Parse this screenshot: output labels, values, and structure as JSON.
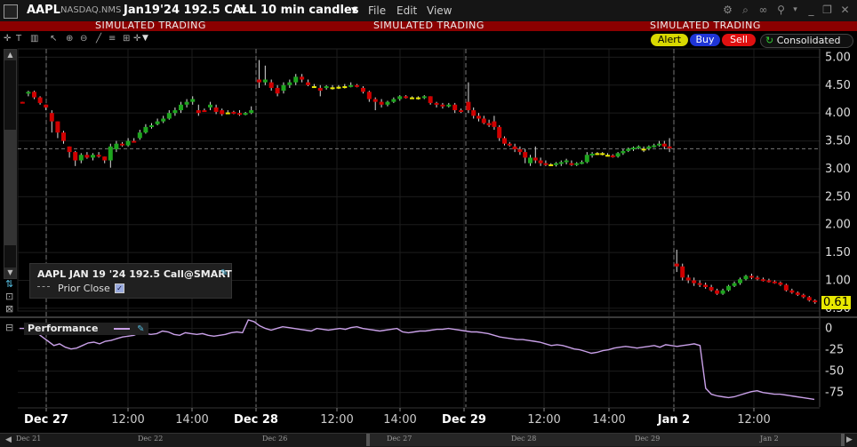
{
  "window": {
    "symbol": "AAPL",
    "exchange": "NASDAQ.NMS",
    "contract": "Jan19'24 192.5 CALL",
    "interval": "10 min candles",
    "menu": [
      "File",
      "Edit",
      "View"
    ]
  },
  "sim_banner": "SIMULATED TRADING",
  "actions": {
    "alert": "Alert",
    "buy": "Buy",
    "sell": "Sell",
    "consolidated": "Consolidated"
  },
  "legend": {
    "title": "AAPL JAN 19 '24 192.5 Call@SMART",
    "prior_close": "Prior Close"
  },
  "performance_label": "Performance",
  "last_price": "0.61",
  "colors": {
    "up": "#1ea51e",
    "down": "#d00000",
    "doji": "#e8e800",
    "performance": "#c9a0e8",
    "sim_bar": "#8b0000",
    "last_price_tag": "#e8e800"
  },
  "icons": [
    "gear-icon",
    "link-icon",
    "pin-icon",
    "minimize-icon",
    "restore-icon",
    "close-icon"
  ],
  "chart_data": [
    {
      "type": "candlestick",
      "y_ticks": [
        5.0,
        4.5,
        4.0,
        3.5,
        3.0,
        2.5,
        2.0,
        1.5,
        1.0,
        0.5
      ],
      "ylim": [
        0.45,
        5.15
      ],
      "prior_close": 3.36,
      "x_labels": [
        "Dec 27",
        "12:00",
        "14:00",
        "Dec 28",
        "12:00",
        "14:00",
        "Dec 29",
        "12:00",
        "14:00",
        "Jan 2",
        "12:00"
      ],
      "sessions": [
        "Dec 27",
        "Dec 28",
        "Dec 29",
        "Jan 2"
      ],
      "series": [
        {
          "segment": 0,
          "ohlc": [
            [
              4.2,
              4.2,
              4.18,
              4.18
            ],
            [
              4.35,
              4.4,
              4.3,
              4.38
            ],
            [
              4.38,
              4.4,
              4.25,
              4.28
            ],
            [
              4.28,
              4.3,
              4.15,
              4.18
            ],
            [
              4.15,
              4.15,
              4.05,
              4.1
            ],
            [
              4.0,
              4.05,
              3.65,
              3.85
            ],
            [
              3.85,
              3.85,
              3.55,
              3.65
            ],
            [
              3.65,
              3.68,
              3.45,
              3.5
            ],
            [
              3.4,
              3.4,
              3.2,
              3.3
            ],
            [
              3.3,
              3.32,
              3.05,
              3.15
            ],
            [
              3.15,
              3.28,
              3.1,
              3.25
            ],
            [
              3.25,
              3.3,
              3.18,
              3.2
            ],
            [
              3.2,
              3.28,
              3.15,
              3.25
            ],
            [
              3.25,
              3.3,
              3.2,
              3.22
            ],
            [
              3.22,
              3.22,
              3.1,
              3.15
            ],
            [
              3.15,
              3.45,
              3.02,
              3.4
            ],
            [
              3.35,
              3.5,
              3.3,
              3.45
            ],
            [
              3.45,
              3.48,
              3.4,
              3.42
            ],
            [
              3.42,
              3.55,
              3.4,
              3.5
            ],
            [
              3.5,
              3.55,
              3.47,
              3.48
            ],
            [
              3.55,
              3.7,
              3.52,
              3.65
            ],
            [
              3.65,
              3.8,
              3.63,
              3.75
            ],
            [
              3.75,
              3.82,
              3.72,
              3.78
            ],
            [
              3.8,
              3.9,
              3.78,
              3.85
            ],
            [
              3.85,
              3.95,
              3.82,
              3.9
            ],
            [
              3.9,
              4.05,
              3.88,
              4.0
            ],
            [
              4.0,
              4.1,
              3.95,
              4.05
            ],
            [
              4.05,
              4.2,
              4.0,
              4.15
            ],
            [
              4.15,
              4.25,
              4.1,
              4.2
            ],
            [
              4.2,
              4.3,
              4.15,
              4.25
            ],
            [
              4.05,
              4.15,
              3.95,
              4.0
            ],
            [
              4.05,
              4.08,
              4.02,
              4.03
            ],
            [
              4.1,
              4.2,
              4.05,
              4.15
            ],
            [
              4.1,
              4.15,
              3.98,
              4.02
            ],
            [
              4.05,
              4.08,
              3.95,
              3.98
            ],
            [
              4.0,
              4.05,
              3.98,
              4.01
            ],
            [
              4.02,
              4.04,
              3.98,
              4.0
            ],
            [
              4.0,
              4.05,
              3.95,
              3.98
            ],
            [
              3.98,
              4.02,
              3.96,
              4.0
            ],
            [
              4.0,
              4.12,
              3.98,
              4.05
            ]
          ]
        },
        {
          "segment": 1,
          "ohlc": [
            [
              4.6,
              4.95,
              4.45,
              4.55
            ],
            [
              4.55,
              4.85,
              4.5,
              4.6
            ],
            [
              4.55,
              4.6,
              4.4,
              4.45
            ],
            [
              4.45,
              4.5,
              4.3,
              4.35
            ],
            [
              4.4,
              4.55,
              4.35,
              4.5
            ],
            [
              4.5,
              4.6,
              4.45,
              4.55
            ],
            [
              4.55,
              4.7,
              4.5,
              4.65
            ],
            [
              4.65,
              4.7,
              4.55,
              4.6
            ],
            [
              4.55,
              4.6,
              4.48,
              4.5
            ],
            [
              4.48,
              4.52,
              4.45,
              4.48
            ],
            [
              4.45,
              4.5,
              4.3,
              4.4
            ],
            [
              4.45,
              4.5,
              4.42,
              4.48
            ],
            [
              4.45,
              4.5,
              4.42,
              4.46
            ],
            [
              4.46,
              4.5,
              4.43,
              4.47
            ],
            [
              4.47,
              4.52,
              4.44,
              4.48
            ],
            [
              4.48,
              4.55,
              4.46,
              4.5
            ],
            [
              4.5,
              4.52,
              4.46,
              4.48
            ],
            [
              4.45,
              4.48,
              4.35,
              4.38
            ],
            [
              4.38,
              4.4,
              4.2,
              4.25
            ],
            [
              4.25,
              4.28,
              4.05,
              4.2
            ],
            [
              4.2,
              4.25,
              4.1,
              4.15
            ],
            [
              4.15,
              4.22,
              4.12,
              4.2
            ],
            [
              4.2,
              4.28,
              4.18,
              4.25
            ],
            [
              4.25,
              4.32,
              4.22,
              4.3
            ],
            [
              4.3,
              4.32,
              4.26,
              4.28
            ],
            [
              4.28,
              4.3,
              4.25,
              4.27
            ],
            [
              4.27,
              4.3,
              4.24,
              4.28
            ],
            [
              4.28,
              4.32,
              4.25,
              4.3
            ],
            [
              4.3,
              4.3,
              4.15,
              4.18
            ],
            [
              4.18,
              4.2,
              4.1,
              4.15
            ],
            [
              4.15,
              4.18,
              4.08,
              4.12
            ],
            [
              4.12,
              4.18,
              4.1,
              4.15
            ],
            [
              4.15,
              4.18,
              4.0,
              4.05
            ],
            [
              4.05,
              4.08,
              4.0,
              4.03
            ]
          ]
        },
        {
          "segment": 2,
          "ohlc": [
            [
              4.2,
              4.55,
              4.0,
              4.05
            ],
            [
              4.05,
              4.1,
              3.9,
              3.95
            ],
            [
              3.95,
              4.0,
              3.85,
              3.9
            ],
            [
              3.9,
              3.95,
              3.8,
              3.82
            ],
            [
              3.82,
              3.88,
              3.75,
              3.78
            ],
            [
              3.85,
              3.95,
              3.7,
              3.75
            ],
            [
              3.75,
              3.78,
              3.5,
              3.55
            ],
            [
              3.55,
              3.58,
              3.42,
              3.45
            ],
            [
              3.45,
              3.48,
              3.4,
              3.42
            ],
            [
              3.4,
              3.45,
              3.3,
              3.35
            ],
            [
              3.35,
              3.4,
              3.25,
              3.3
            ],
            [
              3.3,
              3.35,
              3.1,
              3.2
            ],
            [
              3.1,
              3.25,
              3.05,
              3.2
            ],
            [
              3.2,
              3.4,
              3.1,
              3.15
            ],
            [
              3.15,
              3.2,
              3.05,
              3.1
            ],
            [
              3.1,
              3.15,
              3.05,
              3.08
            ],
            [
              3.08,
              3.1,
              3.05,
              3.07
            ],
            [
              3.07,
              3.12,
              3.04,
              3.1
            ],
            [
              3.1,
              3.15,
              3.05,
              3.12
            ],
            [
              3.12,
              3.18,
              3.08,
              3.15
            ],
            [
              3.1,
              3.15,
              3.05,
              3.08
            ],
            [
              3.08,
              3.12,
              3.05,
              3.1
            ],
            [
              3.1,
              3.15,
              3.08,
              3.12
            ],
            [
              3.12,
              3.3,
              3.1,
              3.25
            ],
            [
              3.25,
              3.3,
              3.2,
              3.27
            ],
            [
              3.27,
              3.3,
              3.25,
              3.28
            ],
            [
              3.28,
              3.3,
              3.24,
              3.27
            ],
            [
              3.25,
              3.28,
              3.22,
              3.24
            ],
            [
              3.24,
              3.26,
              3.2,
              3.22
            ],
            [
              3.22,
              3.3,
              3.2,
              3.28
            ],
            [
              3.28,
              3.35,
              3.25,
              3.32
            ],
            [
              3.32,
              3.38,
              3.3,
              3.36
            ],
            [
              3.36,
              3.4,
              3.32,
              3.38
            ],
            [
              3.38,
              3.42,
              3.35,
              3.4
            ],
            [
              3.35,
              3.4,
              3.3,
              3.36
            ],
            [
              3.36,
              3.42,
              3.33,
              3.4
            ],
            [
              3.4,
              3.45,
              3.38,
              3.42
            ],
            [
              3.42,
              3.5,
              3.4,
              3.45
            ],
            [
              3.45,
              3.5,
              3.35,
              3.4
            ],
            [
              3.4,
              3.55,
              3.3,
              3.38
            ]
          ]
        },
        {
          "segment": 3,
          "ohlc": [
            [
              1.3,
              1.55,
              1.15,
              1.25
            ],
            [
              1.25,
              1.3,
              1.0,
              1.05
            ],
            [
              1.05,
              1.1,
              0.95,
              1.0
            ],
            [
              1.0,
              1.05,
              0.9,
              0.95
            ],
            [
              0.95,
              1.0,
              0.88,
              0.92
            ],
            [
              0.92,
              0.96,
              0.85,
              0.88
            ],
            [
              0.88,
              0.92,
              0.8,
              0.82
            ],
            [
              0.82,
              0.85,
              0.74,
              0.76
            ],
            [
              0.76,
              0.85,
              0.74,
              0.82
            ],
            [
              0.82,
              0.92,
              0.8,
              0.9
            ],
            [
              0.9,
              0.98,
              0.88,
              0.95
            ],
            [
              0.95,
              1.05,
              0.92,
              1.02
            ],
            [
              1.02,
              1.1,
              1.0,
              1.08
            ],
            [
              1.08,
              1.12,
              1.02,
              1.05
            ],
            [
              1.05,
              1.08,
              1.0,
              1.02
            ],
            [
              1.02,
              1.05,
              0.98,
              1.0
            ],
            [
              1.0,
              1.03,
              0.96,
              0.98
            ],
            [
              0.98,
              1.0,
              0.94,
              0.96
            ],
            [
              0.96,
              0.98,
              0.9,
              0.92
            ],
            [
              0.92,
              0.94,
              0.8,
              0.82
            ],
            [
              0.82,
              0.85,
              0.76,
              0.78
            ],
            [
              0.78,
              0.8,
              0.72,
              0.74
            ],
            [
              0.74,
              0.76,
              0.68,
              0.7
            ],
            [
              0.7,
              0.72,
              0.62,
              0.64
            ],
            [
              0.64,
              0.66,
              0.58,
              0.61
            ]
          ]
        }
      ]
    },
    {
      "type": "line",
      "name": "Performance",
      "y_ticks": [
        0,
        -25,
        -50,
        -75
      ],
      "ylim": [
        -92,
        10
      ],
      "values": [
        0,
        0,
        -2,
        -5,
        -10,
        -15,
        -20,
        -18,
        -22,
        -24,
        -23,
        -20,
        -17,
        -16,
        -18,
        -15,
        -14,
        -12,
        -10,
        -9,
        -8,
        -5,
        -6,
        -7,
        -6,
        -3,
        -4,
        -7,
        -8,
        -5,
        -6,
        -7,
        -6,
        -8,
        -9,
        -8,
        -7,
        -5,
        -4,
        -5,
        10,
        8,
        3,
        0,
        -2,
        0,
        2,
        1,
        0,
        -1,
        -2,
        -3,
        0,
        -1,
        -2,
        -1,
        0,
        -1,
        1,
        2,
        0,
        -1,
        -2,
        -3,
        -2,
        -1,
        0,
        -4,
        -5,
        -4,
        -3,
        -3,
        -2,
        -1,
        -1,
        0,
        -1,
        -2,
        -3,
        -4,
        -4,
        -5,
        -6,
        -8,
        -10,
        -11,
        -12,
        -13,
        -13,
        -14,
        -15,
        -16,
        -18,
        -20,
        -19,
        -20,
        -22,
        -24,
        -25,
        -27,
        -29,
        -28,
        -26,
        -25,
        -23,
        -22,
        -21,
        -22,
        -23,
        -22,
        -21,
        -20,
        -22,
        -19,
        -20,
        -21,
        -20,
        -19,
        -18,
        -20,
        -70,
        -77,
        -79,
        -80,
        -81,
        -80,
        -78,
        -76,
        -74,
        -73,
        -75,
        -76,
        -77,
        -77,
        -78,
        -79,
        -80,
        -81,
        -82,
        -83
      ]
    }
  ],
  "bottom_labels": [
    "Dec 21",
    "Dec 22",
    "Dec 26",
    "Dec 27",
    "Dec 28",
    "Dec 29",
    "Jan 2"
  ]
}
